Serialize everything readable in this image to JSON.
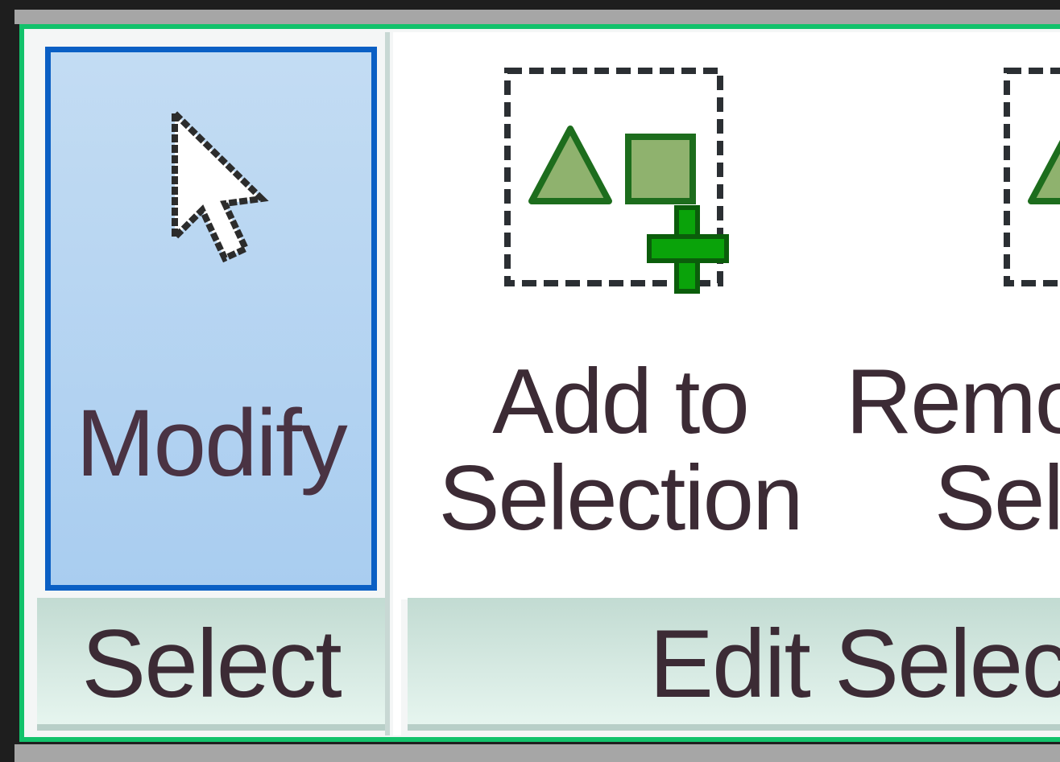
{
  "ribbon": {
    "select_panel": {
      "modify_button": {
        "label": "Modify",
        "icon": "cursor-arrow-icon"
      },
      "group_label": "Select"
    },
    "edit_selection_panel": {
      "add_button": {
        "line1": "Add to",
        "line2": "Selection",
        "icon": "add-to-selection-icon"
      },
      "remove_button": {
        "line1": "Remo",
        "line2": "Sel",
        "icon": "remove-from-selection-icon"
      },
      "group_label": "Edit Select"
    }
  },
  "colors": {
    "active_border": "#0a5fc4",
    "active_fill": "#b6d4f2",
    "focus_outline": "#12c26b",
    "shape_green": "#8fb26e",
    "plus_green": "#0aa30a"
  }
}
